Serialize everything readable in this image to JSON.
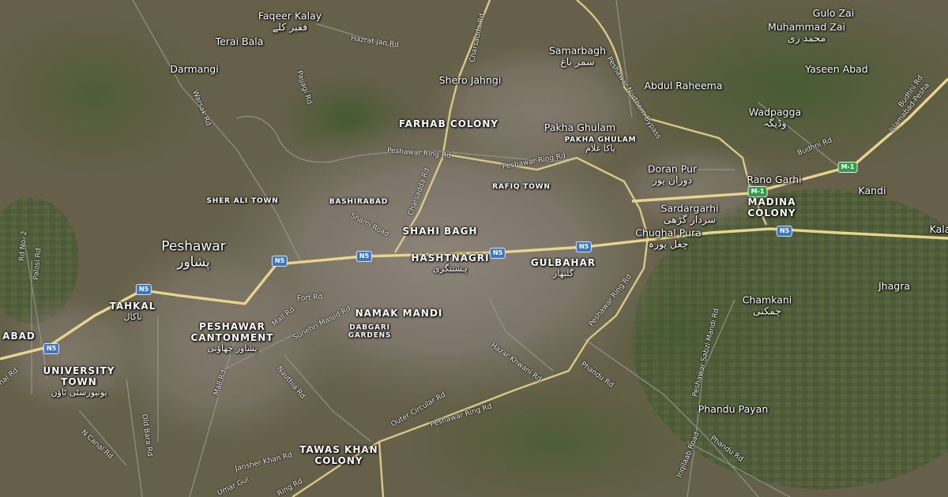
{
  "map": {
    "places": [
      {
        "id": "faqeer-kalay",
        "name": "Faqeer Kalay",
        "urdu": "فقیر کلے"
      },
      {
        "id": "terai-bala",
        "name": "Terai Bala"
      },
      {
        "id": "darmangi",
        "name": "Darmangi"
      },
      {
        "id": "shero-jahngi",
        "name": "Shero Jahngi"
      },
      {
        "id": "samarbagh",
        "name": "Samarbagh",
        "urdu": "سمر باغ"
      },
      {
        "id": "gulo-zai",
        "name": "Gulo Zai"
      },
      {
        "id": "muhammad-zai",
        "name": "Muhammad Zai",
        "urdu": "محمد زی"
      },
      {
        "id": "yaseen-abad",
        "name": "Yaseen Abad"
      },
      {
        "id": "abdul-raheema",
        "name": "Abdul Raheema"
      },
      {
        "id": "wadpagga",
        "name": "Wadpagga",
        "urdu": "وڈپگہ"
      },
      {
        "id": "pakha-ghulam",
        "name": "Pakha Ghulam"
      },
      {
        "id": "doran-pur",
        "name": "Doran Pur",
        "urdu": "دوران پور"
      },
      {
        "id": "rano-garhi",
        "name": "Rano Garhi"
      },
      {
        "id": "kandi",
        "name": "Kandi"
      },
      {
        "id": "sardargarhi",
        "name": "Sardargarhi",
        "urdu": "سردار گڑھی"
      },
      {
        "id": "chughal-pura",
        "name": "Chughal Pura",
        "urdu": "چغل پورہ"
      },
      {
        "id": "kala",
        "name": "Kala"
      },
      {
        "id": "jhagra",
        "name": "Jhagra"
      },
      {
        "id": "chamkani",
        "name": "Chamkani",
        "urdu": "چمکنی"
      },
      {
        "id": "phandu-payan",
        "name": "Phandu Payan"
      }
    ],
    "city": {
      "name": "Peshawar",
      "urdu": "پشاور"
    },
    "districts": [
      {
        "id": "farhab-colony",
        "name": "FARHAB COLONY"
      },
      {
        "id": "shahi-bagh",
        "name": "SHAHI BAGH"
      },
      {
        "id": "hashtnagri",
        "name": "HASHTNAGRI",
        "urdu": "ہشتنگری"
      },
      {
        "id": "gulbahar",
        "name": "GULBAHAR",
        "urdu": "گلبهار"
      },
      {
        "id": "namak-mandi",
        "name": "NAMAK MANDI"
      },
      {
        "id": "tahkal",
        "name": "TAHKAL",
        "urdu": "تاکال"
      },
      {
        "id": "peshawar-cantonment",
        "name": "PESHAWAR CANTONMENT",
        "urdu": "پشاور چھاؤنی"
      },
      {
        "id": "university-town",
        "name": "UNIVERSITY TOWN",
        "urdu": "یونیورسٹی ٹاؤن"
      },
      {
        "id": "madina-colony",
        "name": "MADINA COLONY"
      },
      {
        "id": "tawas-khan-colony",
        "name": "TAWAS KHAN COLONY"
      },
      {
        "id": "abad",
        "name": "ABAD"
      }
    ],
    "small_areas": [
      {
        "id": "pakha-ghulam-area",
        "name": "PAKHA GHULAM",
        "urdu": "پاکا غلام"
      },
      {
        "id": "rafiq-town",
        "name": "RAFIQ TOWN"
      },
      {
        "id": "sher-ali-town",
        "name": "SHER ALI TOWN"
      },
      {
        "id": "bashirabad",
        "name": "BASHIRABAD"
      },
      {
        "id": "dabgari-gardens",
        "name": "DABGARI GARDENS"
      }
    ],
    "roads": [
      {
        "id": "hazrat-jan-rd",
        "name": "Hazrat Jan Rd"
      },
      {
        "id": "charsadda-rd-north",
        "name": "Charsadda Rd"
      },
      {
        "id": "charsadda-rd-south",
        "name": "Charsadda Rd"
      },
      {
        "id": "pajjagi-rd",
        "name": "Pajjagi Rd"
      },
      {
        "id": "warsak-rd",
        "name": "Warsak Rd"
      },
      {
        "id": "peshawar-northern-bypass",
        "name": "Peshawar Northern Bypass"
      },
      {
        "id": "ring-rd-north",
        "name": "Peshawar Ring Rd"
      },
      {
        "id": "ring-rd-northeast",
        "name": "Peshawar Ring Rd"
      },
      {
        "id": "ring-rd-east",
        "name": "Peshawar Ring Rd"
      },
      {
        "id": "ring-rd-south",
        "name": "Peshawar Ring Rd"
      },
      {
        "id": "ring-rd-southwest",
        "name": "Ring Rd"
      },
      {
        "id": "shami-road",
        "name": "Shami Road"
      },
      {
        "id": "budhni-rd-1",
        "name": "Budhni Rd"
      },
      {
        "id": "budhni-rd-2",
        "name": "Budhni Rd"
      },
      {
        "id": "islamabad-peshawar",
        "name": "Islamabad-Pesha"
      },
      {
        "id": "fort-rd",
        "name": "Fort Rd"
      },
      {
        "id": "mall-rd",
        "name": "Mall Rd"
      },
      {
        "id": "sunehri-masjid-rd",
        "name": "Sunehri Masjid Rd"
      },
      {
        "id": "mall-rd-2",
        "name": "Mall Rd"
      },
      {
        "id": "nauthia-rd",
        "name": "Nauthia Rd"
      },
      {
        "id": "old-bara-rd",
        "name": "Old Bara Rd"
      },
      {
        "id": "n-canal-rd",
        "name": "N Canal Rd"
      },
      {
        "id": "rd-no-2",
        "name": "Rd No. 2"
      },
      {
        "id": "palosi-rd",
        "name": "Palosi Rd"
      },
      {
        "id": "jansher-khan-rd",
        "name": "Jansher Khan Rd"
      },
      {
        "id": "umar-gul",
        "name": "Umar Gul"
      },
      {
        "id": "outer-circular-rd",
        "name": "Outer Circular Rd"
      },
      {
        "id": "hazar-khwani-rd",
        "name": "Hazar Khwani Rd"
      },
      {
        "id": "phandu-rd-1",
        "name": "Phandu Rd"
      },
      {
        "id": "phandu-rd-2",
        "name": "Phandu Rd"
      },
      {
        "id": "peshawar-sabzi-mandi-rd",
        "name": "Peshawar Sabzi Mandi Rd"
      },
      {
        "id": "inqilaab-road",
        "name": "Inqilaab Road"
      },
      {
        "id": "nal-rd",
        "name": "nal Rd"
      }
    ],
    "shields": [
      {
        "id": "n5-1",
        "label": "N5"
      },
      {
        "id": "n5-2",
        "label": "N5"
      },
      {
        "id": "n5-3",
        "label": "N5"
      },
      {
        "id": "n5-4",
        "label": "N5"
      },
      {
        "id": "n5-5",
        "label": "N5"
      },
      {
        "id": "n5-6",
        "label": "N5"
      },
      {
        "id": "n5-7",
        "label": "N5"
      },
      {
        "id": "m1-1",
        "label": "M-1"
      },
      {
        "id": "m1-2",
        "label": "M-1"
      }
    ],
    "colors": {
      "highway": "#e8d48a",
      "major_road": "#d9c888",
      "minor_road": "#9a9a92",
      "shield_blue": "#3f76c4",
      "shield_green": "#3a9a4a"
    }
  }
}
